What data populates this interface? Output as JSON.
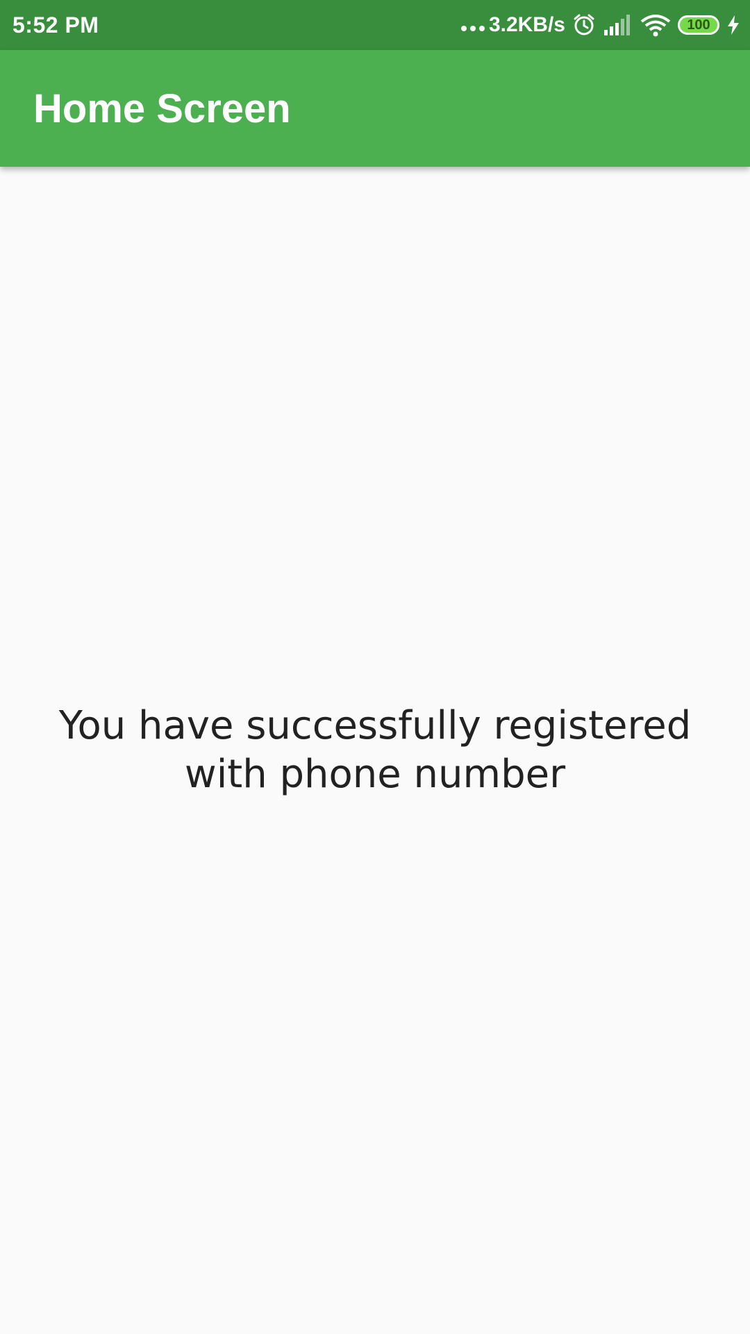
{
  "status_bar": {
    "time": "5:52 PM",
    "network_speed": "3.2KB/s",
    "battery_level": "100",
    "icons": [
      "dots-icon",
      "alarm-icon",
      "signal-icon",
      "wifi-icon",
      "battery-icon",
      "charging-icon"
    ]
  },
  "app_bar": {
    "title": "Home Screen"
  },
  "main": {
    "message": "You have successfully registered with phone number"
  },
  "colors": {
    "status_bar": "#388e3c",
    "app_bar": "#4caf50",
    "background": "#fafafa",
    "text": "#222222"
  }
}
